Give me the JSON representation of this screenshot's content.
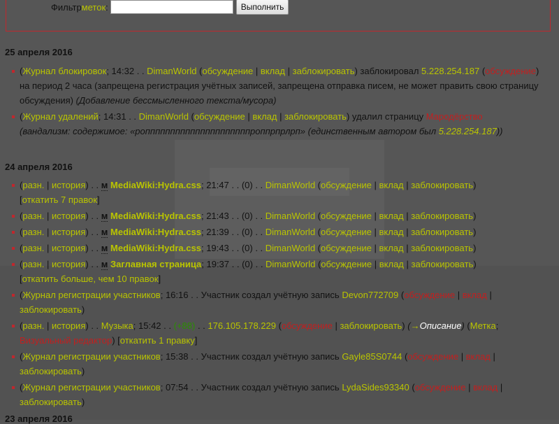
{
  "filter": {
    "label_prefix": "Фильтр ",
    "label_link": "меток",
    "label_suffix": ":",
    "input_value": "",
    "submit_label": "Выполнить"
  },
  "common": {
    "lp": "(",
    "rp": ")",
    "sep": " | ",
    "sp": " ",
    "dots": " . . ",
    "talk": "обсуждение",
    "contribs": "вклад",
    "block": "заблокировать",
    "diff": "разн.",
    "hist": "история",
    "minor": "м",
    "zero": "(0)",
    "talk_open": " (",
    "close": ")",
    "bracket_open": "[",
    "bracket_close": "]",
    "semicolon": "; ",
    "author_user": "DimanWorld",
    "hydra": "MediaWiki:Hydra.css",
    "user_created": "Участник создал учётную запись "
  },
  "day1": {
    "heading": "25 апреля 2016",
    "e1": {
      "log": "Журнал блокировок",
      "time": "14:32",
      "action": " заблокировал ",
      "target": "5.228.254.187",
      "talk2": "обсуждение",
      "rest": ") на период 2 часа (запрещена регистрация учётных записей, запрещена отправка писем, не может править свою страницу обсуждения) ",
      "reason": "(Добавление бессмысленного текста/мусора)"
    },
    "e2": {
      "log": "Журнал удалений",
      "time": "14:31",
      "action": " удалил страницу ",
      "target": "Мародёрство",
      "reason_a": "(вандализм: содержимое: «ропппппппппппппппппппппроппрпрлрп» (единственным автором был ",
      "reason_link": "5.228.254.187",
      "reason_b": "))"
    }
  },
  "day2": {
    "heading": "24 апреля 2016",
    "r1": {
      "time": "21:47",
      "rollback": "откатить 7 правок"
    },
    "r2": {
      "time": "21:43"
    },
    "r3": {
      "time": "21:39"
    },
    "r4": {
      "time": "19:43"
    },
    "r5": {
      "page": "Заглавная страница",
      "time": "19:37",
      "rollback": "откатить больше, чем 10 правок"
    },
    "r6": {
      "log": "Журнал регистрации участников",
      "time": "16:16",
      "user": "Devon772709"
    },
    "r7": {
      "page": "Музыка",
      "time": "15:42",
      "size": "(+88)",
      "ip": "176.105.178.229",
      "arrow": "→",
      "summary": "Описание",
      "tag_label": "Метка",
      "tag_value": "Визуальный редактор",
      "rollback": "откатить 1 правку"
    },
    "r8": {
      "log": "Журнал регистрации участников",
      "time": "15:38",
      "user": "Gayle85S0744"
    },
    "r9": {
      "log": "Журнал регистрации участников",
      "time": "07:54",
      "user": "LydaSides93340"
    }
  },
  "day3": {
    "heading": "23 апреля 2016"
  },
  "colors": {
    "background": "#565656",
    "link": "#b9c400",
    "redlink": "#c21f1f",
    "positive": "#2a8f00",
    "border": "#c0272d"
  }
}
